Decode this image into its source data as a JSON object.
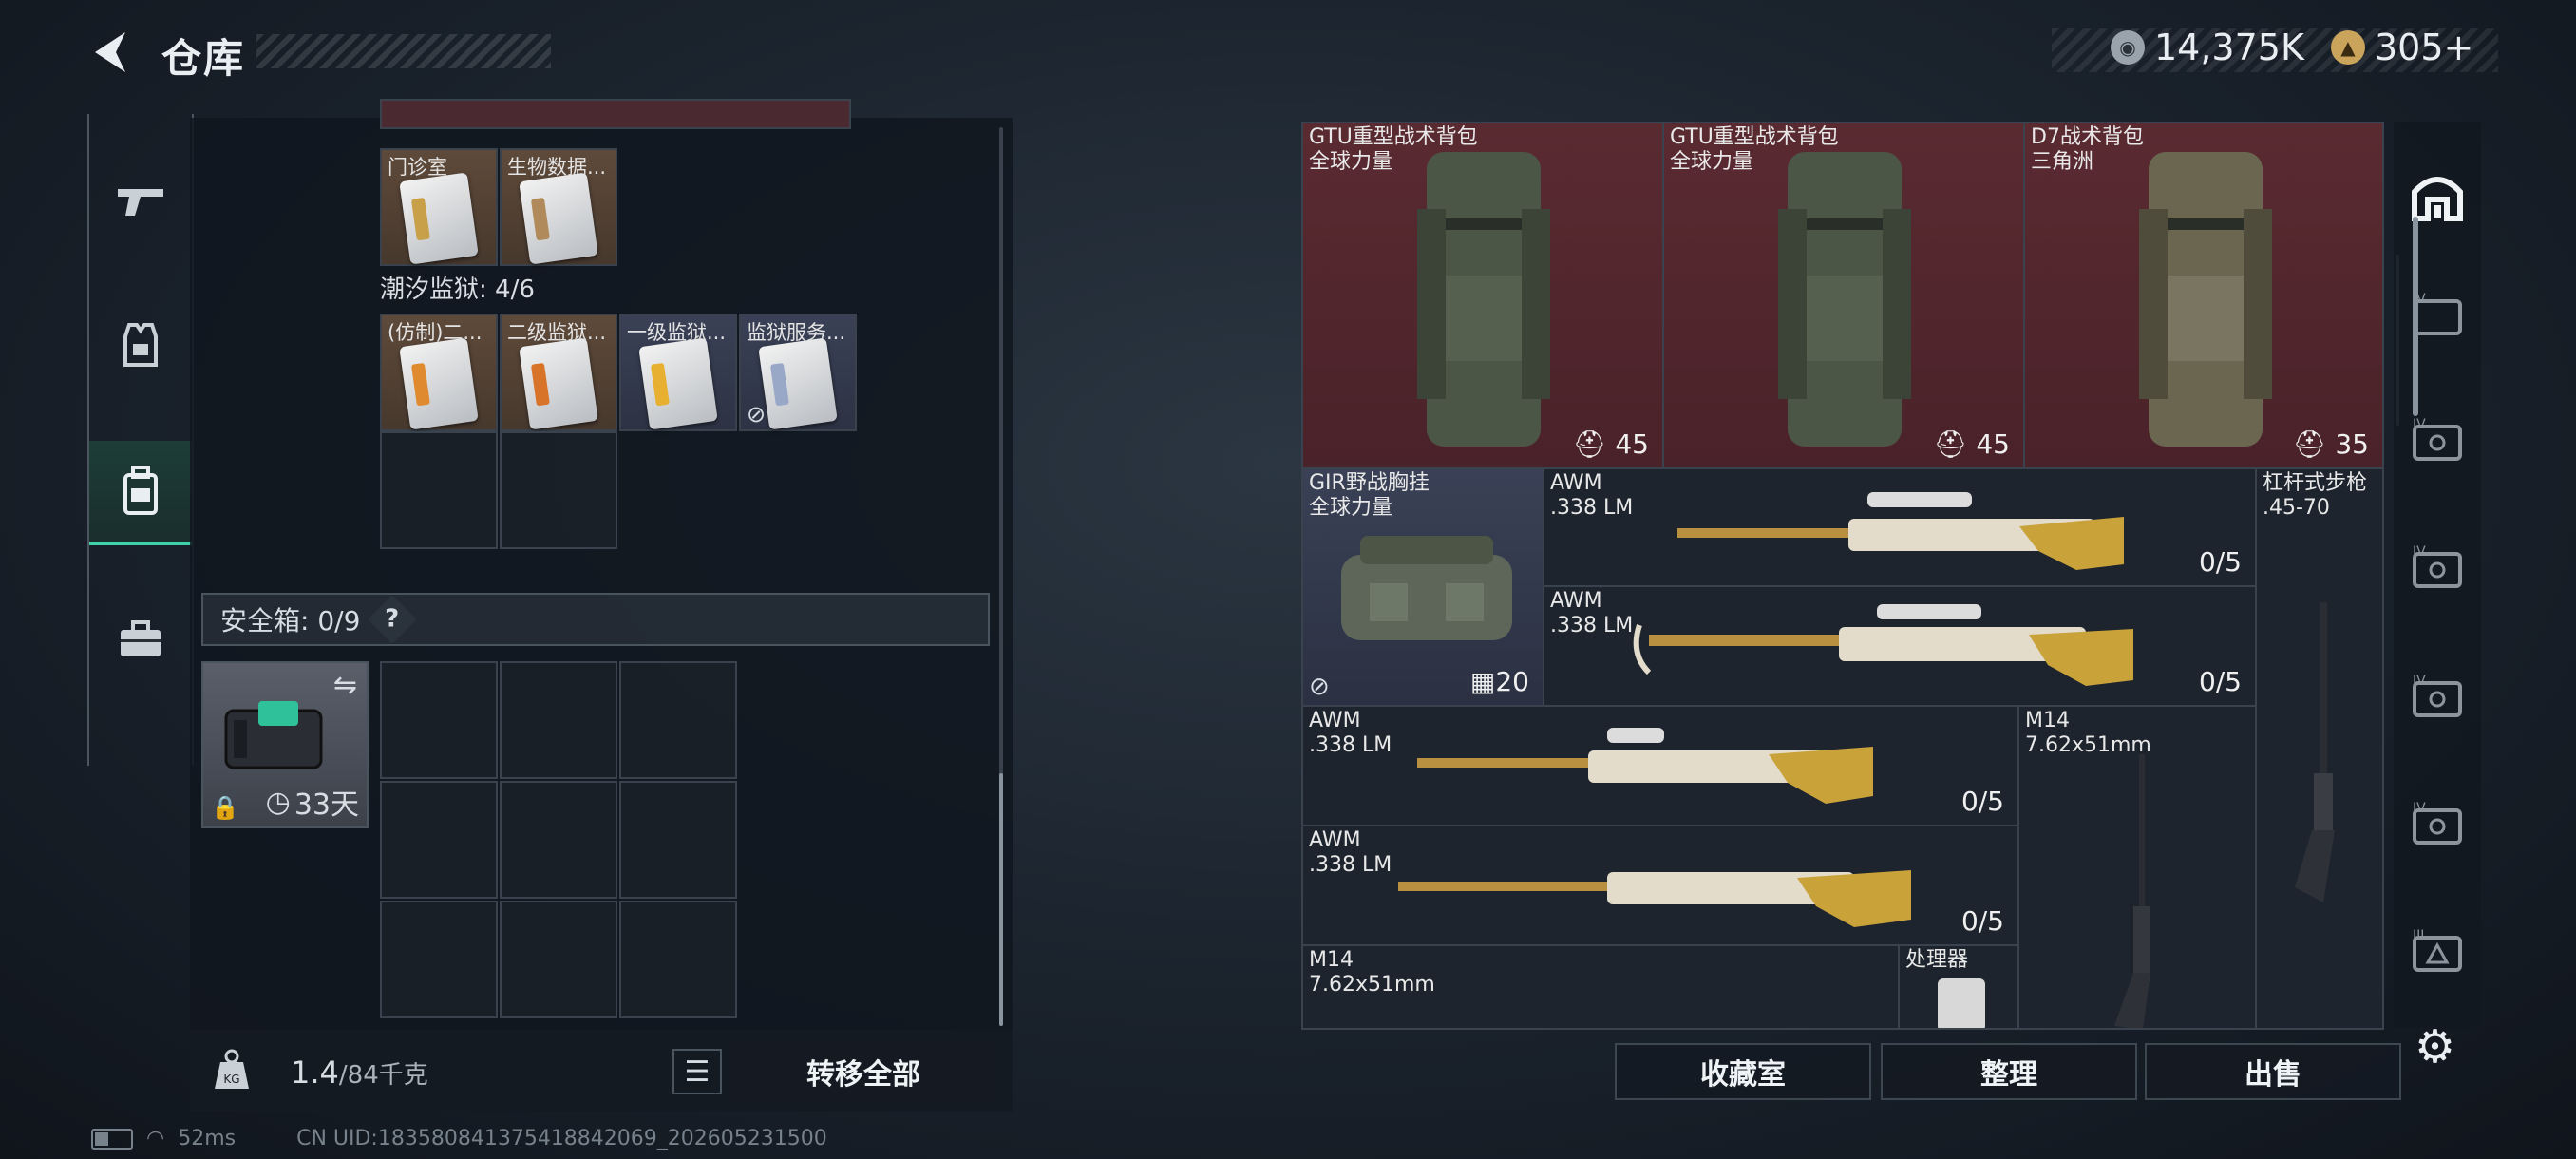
{
  "header": {
    "title": "仓库"
  },
  "currency": {
    "silver": "14,375K",
    "gold": "305+"
  },
  "left": {
    "row1": [
      {
        "label": "门诊室"
      },
      {
        "label": "生物数据..."
      }
    ],
    "section_label": "潮汐监狱: 4/6",
    "row2": [
      {
        "label": "(仿制)二..."
      },
      {
        "label": "二级监狱..."
      },
      {
        "label": "一级监狱..."
      },
      {
        "label": "监狱服务..."
      }
    ],
    "safe_box_label": "安全箱: 0/9",
    "safe_help": "?",
    "safe_time": "33天",
    "weight_value": "1.4",
    "weight_max": "/84千克",
    "transfer_all": "转移全部"
  },
  "right": {
    "items": [
      {
        "name": "GTU重型战术背包\n全球力量",
        "count": "45"
      },
      {
        "name": "GTU重型战术背包\n全球力量",
        "count": "45"
      },
      {
        "name": "D7战术背包\n三角洲",
        "count": "35"
      },
      {
        "name": "GIR野战胸挂\n全球力量",
        "count": "20"
      },
      {
        "name": "AWM\n.338 LM",
        "count": "0/5"
      },
      {
        "name": "AWM\n.338 LM",
        "count": "0/5"
      },
      {
        "name": "杠杆式步枪\n.45-70",
        "count": ""
      },
      {
        "name": "AWM\n.338 LM",
        "count": "0/5"
      },
      {
        "name": "M14\n7.62x51mm",
        "count": ""
      },
      {
        "name": "AWM\n.338 LM",
        "count": "0/5"
      },
      {
        "name": "M14\n7.62x51mm",
        "count": ""
      },
      {
        "name": "处理器",
        "count": ""
      }
    ],
    "buttons": {
      "collection": "收藏室",
      "organize": "整理",
      "sell": "出售"
    }
  },
  "status": {
    "ping": "52ms",
    "uid": "CN UID:1835808413754188420​69_202605231500"
  },
  "colors": {
    "accent": "#3fd2a8",
    "red_cell": "#5a2a31",
    "tan_cell": "#5e4a3a",
    "navy_cell": "#3a4156"
  }
}
